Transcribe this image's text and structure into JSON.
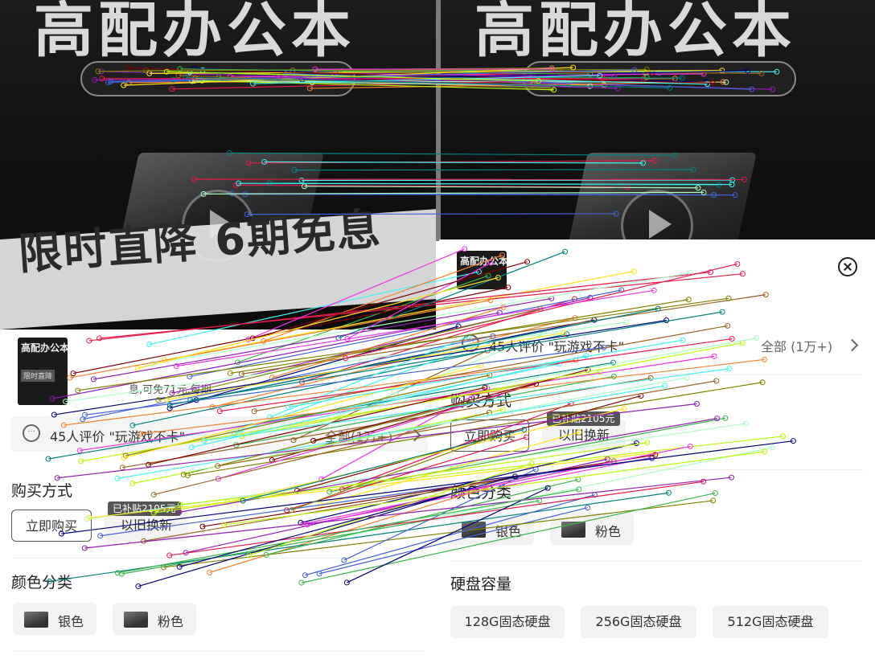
{
  "banner": {
    "title": "高配办公本",
    "promo": "限时直降 6期免息",
    "promo_right_fragment": "6期免息"
  },
  "left_panel": {
    "thumb_title": "高配办公本",
    "thumb_promo": "限时直降",
    "price_note": "息,可免71元,每期",
    "review_count_text": "45人评价 \"玩游戏不卡\"",
    "review_all": "全部(1万+)",
    "purchase_section": "购买方式",
    "buy_now": "立即购买",
    "coupon_tag": "已补贴2105元",
    "installment": "以旧换新",
    "color_section": "颜色分类",
    "colors": [
      "银色",
      "粉色"
    ]
  },
  "right_panel": {
    "thumb_title": "高配办公本",
    "review_count_text": "45人评价 \"玩游戏不卡\"",
    "review_all": "全部 (1万+)",
    "purchase_section": "购买方式",
    "buy_now": "立即购买",
    "coupon_tag": "已补贴2105元",
    "installment": "以旧换新",
    "color_section": "颜色分类",
    "colors": [
      "银色",
      "粉色"
    ],
    "storage_section": "硬盘容量",
    "storage_options": [
      "128G固态硬盘",
      "256G固态硬盘",
      "512G固态硬盘"
    ]
  },
  "icons": {
    "close": "close-icon",
    "comment": "comment-bubble-icon",
    "chevron": "chevron-right-icon",
    "play": "play-icon"
  },
  "colors": {
    "match_palette": [
      "#e6194b",
      "#3cb44b",
      "#ffe119",
      "#4363d8",
      "#f58231",
      "#911eb4",
      "#46f0f0",
      "#f032e6",
      "#bcf60c",
      "#008080",
      "#9a6324",
      "#800000",
      "#aaffc3",
      "#808000",
      "#000075"
    ]
  }
}
